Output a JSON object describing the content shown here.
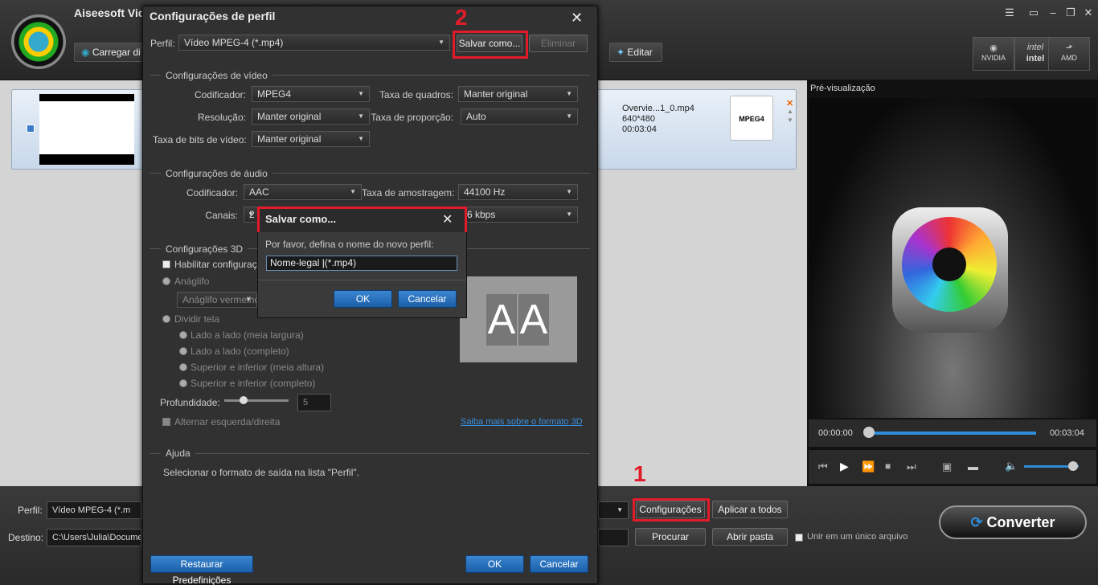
{
  "app": {
    "title": "Aiseesoft Vid",
    "load_button": "Carregar di",
    "edit_button": "Editar",
    "gpu": [
      {
        "icon": "nvidia-icon",
        "label": "NVIDIA"
      },
      {
        "icon": "intel-icon",
        "icon_text": "intel",
        "label": "intel"
      },
      {
        "icon": "amd-icon",
        "label": "AMD"
      }
    ],
    "file": {
      "name": "Overvie...1_0.mp4",
      "resolution": "640*480",
      "duration": "00:03:04",
      "format_icon": "MPEG4"
    },
    "preview": {
      "title": "Pré-visualização",
      "time_start": "00:00:00",
      "time_end": "00:03:04",
      "progress": 0.0,
      "volume": 0.8
    },
    "bottom": {
      "profile_label": "Perfil:",
      "profile_value": "Vídeo MPEG-4 (*.m",
      "settings_button": "Configurações",
      "apply_all_button": "Aplicar a todos",
      "dest_label": "Destino:",
      "dest_value": "C:\\Users\\Julia\\Documen",
      "browse_button": "Procurar",
      "open_folder_button": "Abrir pasta",
      "merge_label": "Unir em um único arquivo",
      "convert_button": "Converter"
    },
    "annotations": {
      "num1": "1",
      "num2": "2"
    }
  },
  "dialog": {
    "title": "Configurações de perfil",
    "profile_label": "Perfil:",
    "profile_value": "Vídeo MPEG-4 (*.mp4)",
    "save_as_button": "Salvar como...",
    "delete_button": "Eliminar",
    "video": {
      "section": "Configurações de vídeo",
      "encoder_label": "Codificador:",
      "encoder_value": "MPEG4",
      "framerate_label": "Taxa de quadros:",
      "framerate_value": "Manter original",
      "resolution_label": "Resolução:",
      "resolution_value": "Manter original",
      "aspect_label": "Taxa de proporção:",
      "aspect_value": "Auto",
      "bitrate_label": "Taxa de bits de vídeo:",
      "bitrate_value": "Manter original"
    },
    "audio": {
      "section": "Configurações de áudio",
      "encoder_label": "Codificador:",
      "encoder_value": "AAC",
      "samplerate_label": "Taxa de amostragem:",
      "samplerate_value": "44100 Hz",
      "channels_label": "Canais:",
      "channels_value": "2",
      "bitrate_value": "6 kbps"
    },
    "three_d": {
      "section": "Configurações 3D",
      "enable_label": "Habilitar configuraçõ",
      "anaglyph_label": "Anáglifo",
      "anaglyph_value": "Anáglifo vermelho/",
      "split_label": "Dividir tela",
      "options": [
        "Lado a lado (meia largura)",
        "Lado a lado (completo)",
        "Superior e inferior (meia altura)",
        "Superior e inferior (completo)"
      ],
      "depth_label": "Profundidade:",
      "depth_value": "5",
      "swap_label": "Alternar esquerda/direita",
      "learn_more_link": "Saiba mais sobre o formato 3D",
      "preview_letters": [
        "A",
        "A"
      ]
    },
    "help": {
      "section": "Ajuda",
      "text": "Selecionar o formato de saída na lista \"Perfil\"."
    },
    "restore_button": "Restaurar Predefinições",
    "ok_button": "OK",
    "cancel_button": "Cancelar"
  },
  "save_dialog": {
    "title": "Salvar como...",
    "prompt": "Por favor, defina o nome do novo perfil:",
    "input_value": "Nome-legal |(*.mp4)",
    "ok_button": "OK",
    "cancel_button": "Cancelar"
  }
}
